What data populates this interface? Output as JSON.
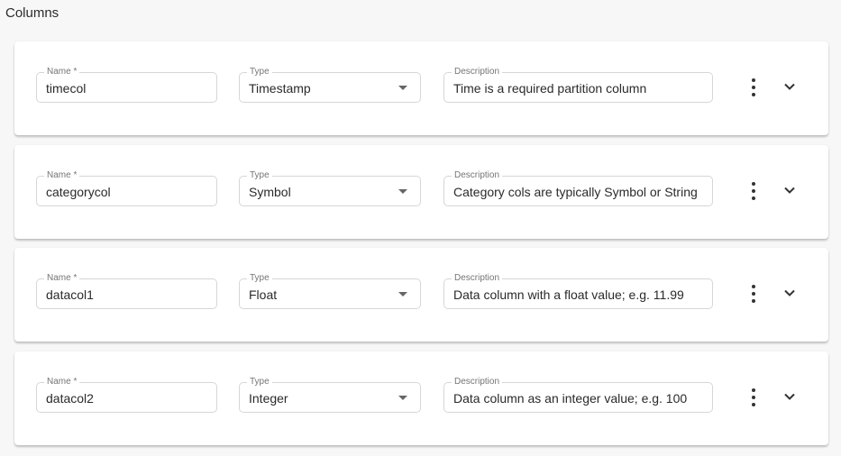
{
  "section_title": "Columns",
  "labels": {
    "name": "Name *",
    "type": "Type",
    "description": "Description"
  },
  "icons": {
    "more": "more-vertical-icon",
    "expand": "chevron-down-icon",
    "dropdown": "dropdown-arrow-icon"
  },
  "columns": [
    {
      "name": "timecol",
      "type": "Timestamp",
      "description": "Time is a required partition column"
    },
    {
      "name": "categorycol",
      "type": "Symbol",
      "description": "Category cols are typically Symbol or String"
    },
    {
      "name": "datacol1",
      "type": "Float",
      "description": "Data column with a float value; e.g. 11.99"
    },
    {
      "name": "datacol2",
      "type": "Integer",
      "description": "Data column as an integer value; e.g. 100"
    }
  ]
}
